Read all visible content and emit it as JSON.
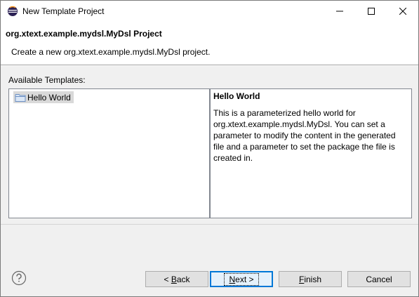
{
  "window": {
    "title": "New Template Project",
    "icons": {
      "app": "eclipse-icon",
      "minimize": "minimize-icon",
      "maximize": "maximize-icon",
      "close": "close-icon"
    }
  },
  "header": {
    "title": "org.xtext.example.mydsl.MyDsl Project",
    "description": "Create a new org.xtext.example.mydsl.MyDsl project."
  },
  "templates": {
    "label": "Available Templates:",
    "items": [
      {
        "label": "Hello World",
        "icon": "folder-icon",
        "selected": true
      }
    ]
  },
  "details": {
    "title": "Hello World",
    "body": "This is a parameterized hello world for org.xtext.example.mydsl.MyDsl. You can set a parameter to modify the content in the generated file and a parameter to set the package the file is created in."
  },
  "buttons": {
    "help_icon": "help-icon",
    "back_prefix": "< ",
    "back_mnemonic": "B",
    "back_rest": "ack",
    "next_mnemonic": "N",
    "next_rest": "ext >",
    "finish_mnemonic": "F",
    "finish_rest": "inish",
    "cancel": "Cancel"
  },
  "colors": {
    "focus_border": "#0078d7",
    "selection_bg": "#d9d9d9",
    "window_bg": "#f0f0f0"
  }
}
